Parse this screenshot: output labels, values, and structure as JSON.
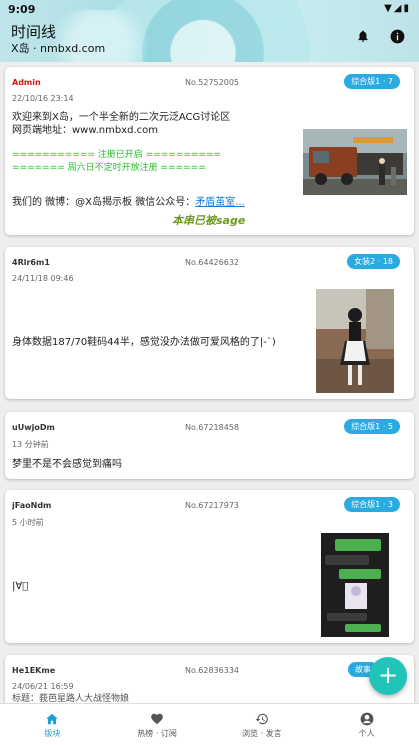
{
  "status_bar": {
    "time": "9:09"
  },
  "header": {
    "title": "时间线",
    "subtitle": "X岛 · nmbxd.com"
  },
  "posts": [
    {
      "user": "Admin",
      "no": "No.52752005",
      "tag": "综合版1 · 7",
      "time": "22/10/16 23:14",
      "lines": [
        "欢迎来到X岛，一个半全新的二次元泛ACG讨论区",
        "网页端地址：www.nmbxd.com"
      ],
      "green_lines": [
        "=========== 注册已开启 ==========",
        "======= 周六日不定时开放注册 ======"
      ],
      "weibo": "我们的 微博：@X岛揭示板   微信公众号：",
      "weibo_link": "矛盾茧室...",
      "sage": "本串已被sage"
    },
    {
      "user": "4Rlr6m1",
      "no": "No.64426632",
      "tag": "女装2 · 18",
      "time": "24/11/18 09:46",
      "lines": [
        "身体数据187/70鞋码44半，感觉没办法做可爱风格的了|-`)"
      ]
    },
    {
      "user": "uUwjoDm",
      "no": "No.67218458",
      "tag": "综合版1 · 5",
      "time": "13 分钟前",
      "lines": [
        "梦里不是不会感觉到痛吗"
      ]
    },
    {
      "user": "jFaoNdm",
      "no": "No.67217973",
      "tag": "综合版1 · 3",
      "time": "5 小时前",
      "lines": [
        "|∀ﾟ"
      ]
    },
    {
      "user": "He1EKme",
      "no": "No.62836334",
      "tag": "故事",
      "time": "24/06/21 16:59",
      "lines": [
        "标题：莪芭星路人大战怪物娘"
      ]
    }
  ],
  "nav": [
    {
      "label": "版块",
      "icon": "home-icon"
    },
    {
      "label": "热榜 · 订阅",
      "icon": "heart-icon"
    },
    {
      "label": "浏览 · 发言",
      "icon": "history-icon"
    },
    {
      "label": "个人",
      "icon": "person-icon"
    }
  ],
  "colors": {
    "accent": "#29abe2",
    "fab": "#22c4b9",
    "sage": "#6b9a1e",
    "green_text": "#22c422"
  }
}
